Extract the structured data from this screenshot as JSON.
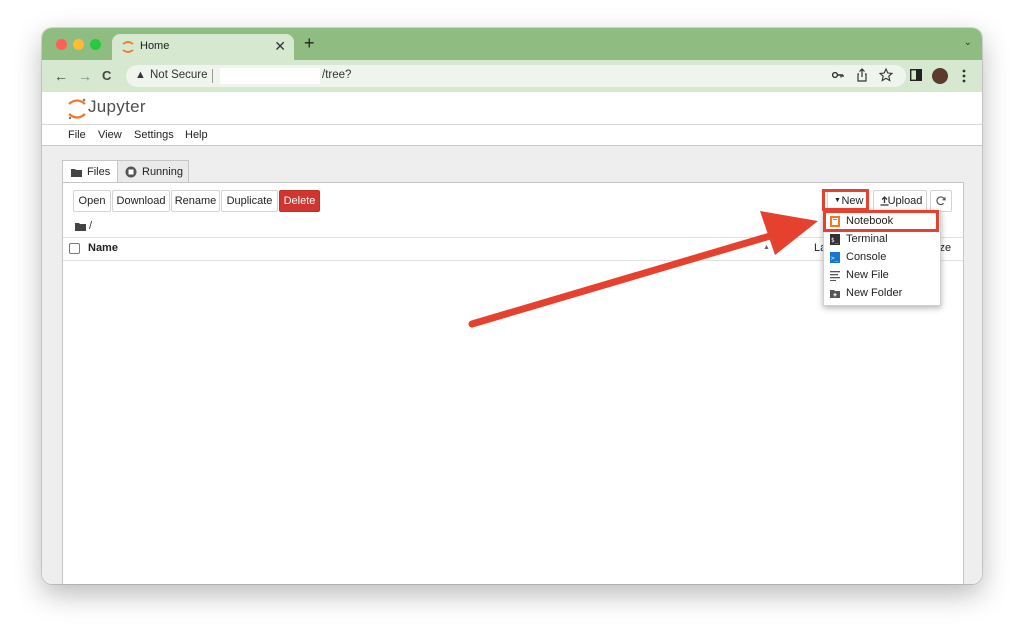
{
  "browser": {
    "tab_title": "Home",
    "new_tab_glyph": "+",
    "close_glyph": "✕",
    "tabs_menu_glyph": "⌄",
    "nav": {
      "back": "←",
      "forward": "→",
      "reload": "C"
    },
    "security_label": "Not Secure",
    "url_path": "/tree?",
    "icons": [
      "key-icon",
      "share-icon",
      "star-icon",
      "sidepanel-icon",
      "avatar",
      "kebab-menu-icon"
    ],
    "colors": {
      "frame": "#8fbd81",
      "toolbar": "#d6e8cf"
    }
  },
  "jupyter": {
    "brand": "Jupyter",
    "logo_color": "#f37726",
    "menu": [
      "File",
      "View",
      "Settings",
      "Help"
    ],
    "tabs": [
      {
        "label": "Files",
        "icon": "folder-icon",
        "active": true
      },
      {
        "label": "Running",
        "icon": "running-icon",
        "active": false
      }
    ],
    "actions": [
      "Open",
      "Download",
      "Rename",
      "Duplicate",
      "Delete"
    ],
    "right_actions": {
      "new": "New",
      "upload": "Upload",
      "refresh_icon": "refresh-icon"
    },
    "breadcrumb": "/",
    "columns": {
      "name": "Name",
      "modified": "La",
      "size": "ize"
    },
    "new_menu": [
      {
        "label": "Notebook",
        "icon": "notebook-icon"
      },
      {
        "label": "Terminal",
        "icon": "terminal-icon"
      },
      {
        "label": "Console",
        "icon": "console-icon"
      },
      {
        "label": "New File",
        "icon": "file-icon"
      },
      {
        "label": "New Folder",
        "icon": "new-folder-icon"
      }
    ],
    "colors": {
      "delete": "#d0352f",
      "highlight": "#e5412e"
    }
  }
}
